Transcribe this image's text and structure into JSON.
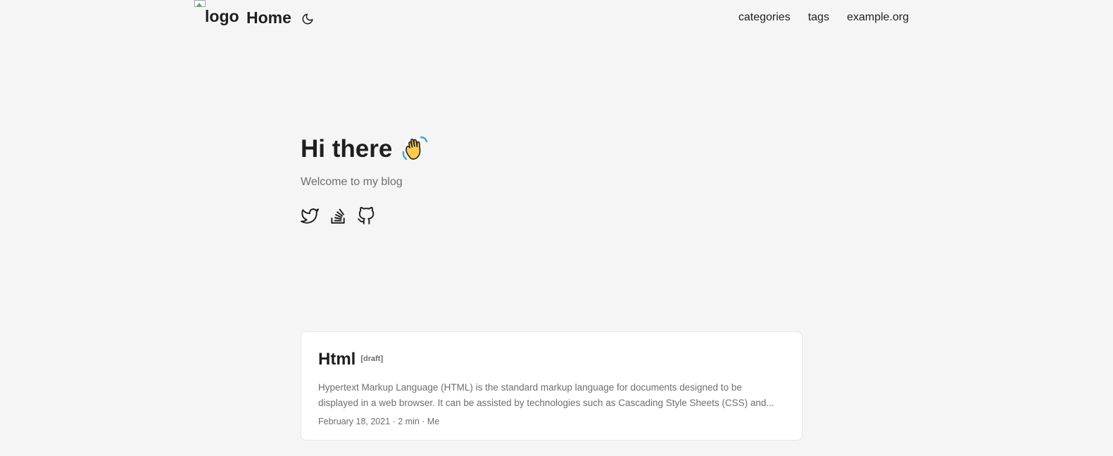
{
  "header": {
    "logo_alt": "logo",
    "home_label": "Home",
    "theme_toggle_icon": "moon-icon",
    "nav": [
      {
        "label": "categories"
      },
      {
        "label": "tags"
      },
      {
        "label": "example.org"
      }
    ]
  },
  "hero": {
    "title": "Hi there",
    "emoji_icon": "waving-hand-icon",
    "subtitle": "Welcome to my blog",
    "social": [
      {
        "icon": "twitter-icon"
      },
      {
        "icon": "stackoverflow-icon"
      },
      {
        "icon": "github-icon"
      }
    ]
  },
  "posts": [
    {
      "title": "Html",
      "badge": "[draft]",
      "summary": "Hypertext Markup Language (HTML) is the standard markup language for documents designed to be displayed in a web browser. It can be assisted by technologies such as Cascading Style Sheets (CSS) and...",
      "meta": "February 18, 2021 · 2 min · Me"
    }
  ],
  "colors": {
    "background": "#f5f5f5",
    "text": "#1e1e1e",
    "muted": "#6e6e6e",
    "card": "#ffffff"
  }
}
